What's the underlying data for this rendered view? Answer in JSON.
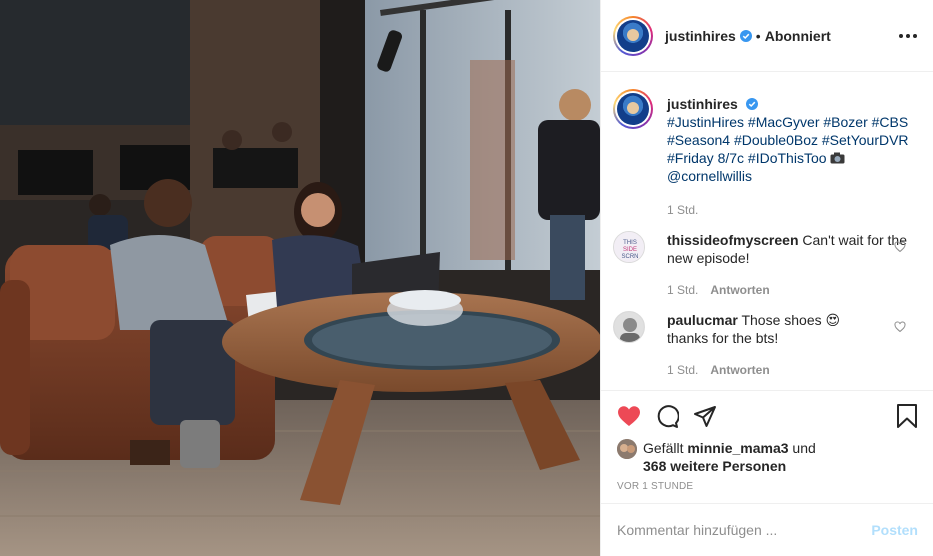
{
  "post": {
    "username": "justinhires",
    "follow_status": "Abonniert",
    "caption_user": "justinhires",
    "caption_lines": [
      "#JustinHires #MacGyver #Bozer #CBS",
      "#Season4 #Double0Boz #SetYourDVR",
      "#Friday 8/7c #IDoThisToo",
      "@cornellwillis"
    ],
    "caption_camera_icon": "camera-emoji",
    "caption_time": "1 Std."
  },
  "comments": [
    {
      "user": "thissideofmyscreen",
      "text": "Can't wait for the new episode!",
      "time": "1 Std.",
      "reply": "Antworten"
    },
    {
      "user": "paulucmar",
      "text": "Those shoes",
      "emoji": "😍",
      "text2": "thanks for the bts!",
      "time": "1 Std.",
      "reply": "Antworten"
    }
  ],
  "likes": {
    "prefix": "Gefällt",
    "user": "minnie_mama3",
    "mid": "und",
    "others": "368 weitere Personen"
  },
  "timestamp": "VOR 1 STUNDE",
  "comment_box": {
    "placeholder": "Kommentar hinzufügen ...",
    "post_label": "Posten"
  },
  "colors": {
    "accent": "#0095f6",
    "like": "#ed4956",
    "verified": "#3897f0",
    "post_disabled": "#b2dffc"
  }
}
